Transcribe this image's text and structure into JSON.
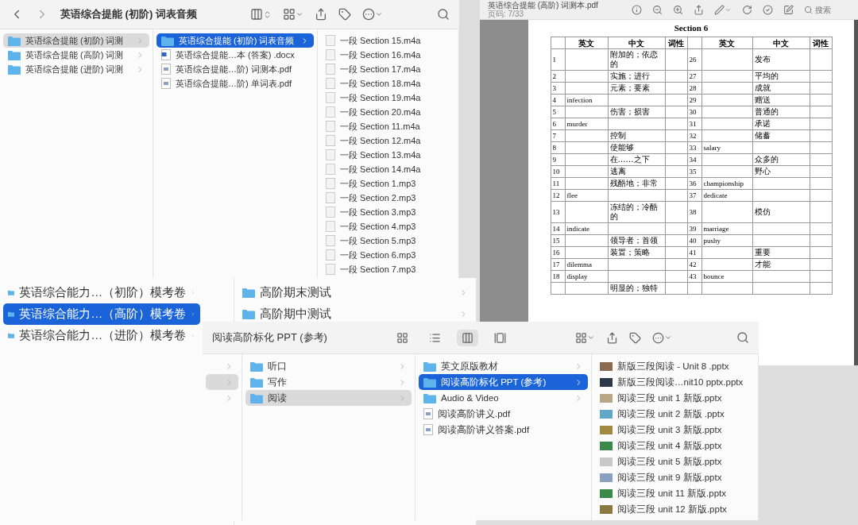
{
  "finder_top": {
    "title": "英语综合提能 (初阶) 词表音频",
    "columns": [
      {
        "focused": false,
        "items": [
          {
            "name": "英语综合提能 (初阶) 词测",
            "kind": "folder",
            "selected": true
          },
          {
            "name": "英语综合提能 (高阶) 词测",
            "kind": "folder",
            "selected": false
          },
          {
            "name": "英语综合提能 (进阶) 词测",
            "kind": "folder",
            "selected": false
          }
        ]
      },
      {
        "focused": true,
        "items": [
          {
            "name": "英语综合提能 (初阶) 词表音频",
            "kind": "folder",
            "selected": true
          },
          {
            "name": "英语综合提能…本 (答案) .docx",
            "kind": "docx",
            "selected": false
          },
          {
            "name": "英语综合提能…阶) 词测本.pdf",
            "kind": "pdf",
            "selected": false
          },
          {
            "name": "英语综合提能…阶) 单词表.pdf",
            "kind": "pdf",
            "selected": false
          }
        ]
      },
      {
        "items": [
          {
            "name": "一段 Section 15.m4a",
            "kind": "audio",
            "selected": false
          },
          {
            "name": "一段 Section 16.m4a",
            "kind": "audio",
            "selected": false
          },
          {
            "name": "一段 Section 17.m4a",
            "kind": "audio",
            "selected": false
          },
          {
            "name": "一段 Section 18.m4a",
            "kind": "audio",
            "selected": false
          },
          {
            "name": "一段 Section 19.m4a",
            "kind": "audio",
            "selected": false
          },
          {
            "name": "一段 Section 20.m4a",
            "kind": "audio",
            "selected": false
          },
          {
            "name": "一段 Section 11.m4a",
            "kind": "audio",
            "selected": false
          },
          {
            "name": "一段 Section 12.m4a",
            "kind": "audio",
            "selected": false
          },
          {
            "name": "一段 Section 13.m4a",
            "kind": "audio",
            "selected": false
          },
          {
            "name": "一段 Section 14.m4a",
            "kind": "audio",
            "selected": false
          },
          {
            "name": "一段 Section 1.mp3",
            "kind": "audio",
            "selected": false
          },
          {
            "name": "一段 Section 2.mp3",
            "kind": "audio",
            "selected": false
          },
          {
            "name": "一段 Section 3.mp3",
            "kind": "audio",
            "selected": false
          },
          {
            "name": "一段 Section 4.mp3",
            "kind": "audio",
            "selected": false
          },
          {
            "name": "一段 Section 5.mp3",
            "kind": "audio",
            "selected": false
          },
          {
            "name": "一段 Section 6.mp3",
            "kind": "audio",
            "selected": false
          },
          {
            "name": "一段 Section 7.mp3",
            "kind": "audio",
            "selected": false
          }
        ]
      }
    ]
  },
  "pdf_viewer": {
    "title": "英语综合提能 (高阶) 词测本.pdf",
    "subtitle": "页码: 7/33",
    "search": {
      "placeholder": "搜索"
    },
    "page": {
      "heading": "Section 6",
      "header": [
        "英文",
        "中文",
        "词性",
        "英文",
        "中文",
        "词性"
      ],
      "rows": [
        {
          "no": "1",
          "cn": "附加的；依恋的",
          "no2": "26",
          "cn2": "发布"
        },
        {
          "no": "2",
          "cn": "实施；进行",
          "no2": "27",
          "cn2": "平均的"
        },
        {
          "no": "3",
          "cn": "元素；要素",
          "no2": "28",
          "cn2": "成就"
        },
        {
          "no": "4",
          "en": "infection",
          "no2": "29",
          "cn2": "赠送"
        },
        {
          "no": "5",
          "cn": "伤害；损害",
          "no2": "30",
          "cn2": "普通的"
        },
        {
          "no": "6",
          "en": "murder",
          "no2": "31",
          "cn2": "承诺"
        },
        {
          "no": "7",
          "cn": "控制",
          "no2": "32",
          "cn2": "储蓄"
        },
        {
          "no": "8",
          "cn": "使能够",
          "no2": "33",
          "en2": "salary"
        },
        {
          "no": "9",
          "cn": "在……之下",
          "no2": "34",
          "cn2": "众多的"
        },
        {
          "no": "10",
          "cn": "逃离",
          "no2": "35",
          "cn2": "野心"
        },
        {
          "no": "11",
          "cn": "残酷地；非常",
          "no2": "36",
          "en2": "championship"
        },
        {
          "no": "12",
          "en": "flee",
          "no2": "37",
          "en2": "dedicate"
        },
        {
          "no": "13",
          "cn": "冻结的；冷酷的",
          "no2": "38",
          "cn2": "模仿"
        },
        {
          "no": "14",
          "en": "indicate",
          "no2": "39",
          "en2": "marriage"
        },
        {
          "no": "15",
          "cn": "领导者；首领",
          "no2": "40",
          "en2": "pushy"
        },
        {
          "no": "16",
          "cn": "装置；策略",
          "no2": "41",
          "cn2": "重要"
        },
        {
          "no": "17",
          "en": "dilemma",
          "no2": "42",
          "cn2": "才能"
        },
        {
          "no": "18",
          "en": "display",
          "no2": "43",
          "en2": "bounce"
        },
        {
          "cn": "明显的；独特"
        }
      ]
    }
  },
  "finder_middle": {
    "columns": [
      {
        "focused": true,
        "items": [
          {
            "name": "英语综合能力…（初阶）模考卷",
            "kind": "folder",
            "selected": false
          },
          {
            "name": "英语综合能力…（高阶）模考卷",
            "kind": "folder",
            "selected": true
          },
          {
            "name": "英语综合能力…（进阶）模考卷",
            "kind": "folder",
            "selected": false
          }
        ]
      },
      {
        "items": [
          {
            "name": "高阶期末测试",
            "kind": "folder",
            "selected": false
          },
          {
            "name": "高阶期中测试",
            "kind": "folder",
            "selected": false
          }
        ]
      }
    ]
  },
  "finder_bottom": {
    "title": "阅读高阶标化 PPT (参考)",
    "columns": [
      {
        "focused": false,
        "items": [
          {
            "kind": "stub",
            "selected": false
          },
          {
            "kind": "stub",
            "selected": true
          },
          {
            "kind": "stub",
            "selected": false
          }
        ]
      },
      {
        "focused": false,
        "items": [
          {
            "name": "听口",
            "kind": "folder",
            "selected": false
          },
          {
            "name": "写作",
            "kind": "folder",
            "selected": false
          },
          {
            "name": "阅读",
            "kind": "folder",
            "selected": true
          }
        ]
      },
      {
        "focused": true,
        "items": [
          {
            "name": "英文原版教材",
            "kind": "folder",
            "selected": false
          },
          {
            "name": "阅读高阶标化 PPT (参考)",
            "kind": "folder",
            "selected": true
          },
          {
            "name": "Audio & Video",
            "kind": "folder",
            "selected": false
          },
          {
            "name": "阅读高阶讲义.pdf",
            "kind": "pdf",
            "selected": false
          },
          {
            "name": "阅读高阶讲义答案.pdf",
            "kind": "pdf",
            "selected": false
          }
        ]
      },
      {
        "items": [
          {
            "name": "新版三段阅读 - Unit 8 .pptx",
            "kind": "pptx",
            "color": "#8a6a50",
            "selected": false
          },
          {
            "name": "新版三段阅读…nit10 pptx.pptx",
            "kind": "pptx",
            "color": "#2a3a4a",
            "selected": false
          },
          {
            "name": "阅读三段 unit 1 新版.pptx",
            "kind": "pptx",
            "color": "#b8a888",
            "selected": false
          },
          {
            "name": "阅读三段 unit 2 新版 .pptx",
            "kind": "pptx",
            "color": "#5fa8c8",
            "selected": false
          },
          {
            "name": "阅读三段 unit 3 新版.pptx",
            "kind": "pptx",
            "color": "#a08a40",
            "selected": false
          },
          {
            "name": "阅读三段 unit 4 新版.pptx",
            "kind": "pptx",
            "color": "#3a8a4a",
            "selected": false
          },
          {
            "name": "阅读三段 unit 5 新版.pptx",
            "kind": "pptx",
            "color": "#c8c8c8",
            "selected": false
          },
          {
            "name": "阅读三段 unit 9 新版.pptx",
            "kind": "pptx",
            "color": "#8aa0c0",
            "selected": false
          },
          {
            "name": "阅读三段 unit 11 新版.pptx",
            "kind": "pptx",
            "color": "#3a8a4a",
            "selected": false
          },
          {
            "name": "阅读三段 unit 12 新版.pptx",
            "kind": "pptx",
            "color": "#8a7a40",
            "selected": false
          }
        ]
      }
    ]
  }
}
